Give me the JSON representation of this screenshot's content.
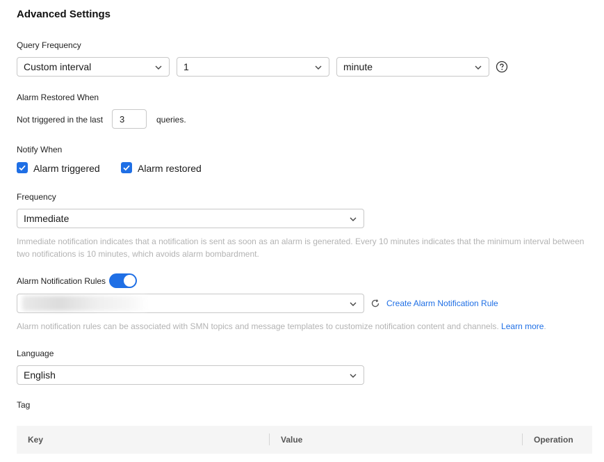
{
  "section_title": "Advanced Settings",
  "query_frequency": {
    "label": "Query Frequency",
    "type_value": "Custom interval",
    "count_value": "1",
    "unit_value": "minute",
    "help_icon": "question-circle-icon"
  },
  "alarm_restored": {
    "label": "Alarm Restored When",
    "prefix": "Not triggered in the last",
    "value": "3",
    "suffix": "queries."
  },
  "notify_when": {
    "label": "Notify When",
    "options": [
      {
        "label": "Alarm triggered",
        "checked": true
      },
      {
        "label": "Alarm restored",
        "checked": true
      }
    ]
  },
  "frequency": {
    "label": "Frequency",
    "value": "Immediate",
    "help_line1": "Immediate notification indicates that a notification is sent as soon as an alarm is generated. Every 10 minutes indicates that the minimum interval between",
    "help_line2": "two notifications is 10 minutes, which avoids alarm bombardment."
  },
  "notification_rules": {
    "label": "Alarm Notification Rules",
    "enabled": true,
    "refresh_icon": "refresh-icon",
    "create_link": "Create Alarm Notification Rule",
    "help_text": "Alarm notification rules can be associated with SMN topics and message templates to customize notification content and channels.",
    "learn_more": "Learn more",
    "learn_more_suffix": "."
  },
  "language": {
    "label": "Language",
    "value": "English"
  },
  "tag": {
    "label": "Tag",
    "columns": [
      "Key",
      "Value",
      "Operation"
    ]
  },
  "colors": {
    "accent": "#1f6fe5",
    "help_text": "#b3b3b3",
    "border": "#c8c8c8",
    "table_header_bg": "#f5f5f5"
  }
}
